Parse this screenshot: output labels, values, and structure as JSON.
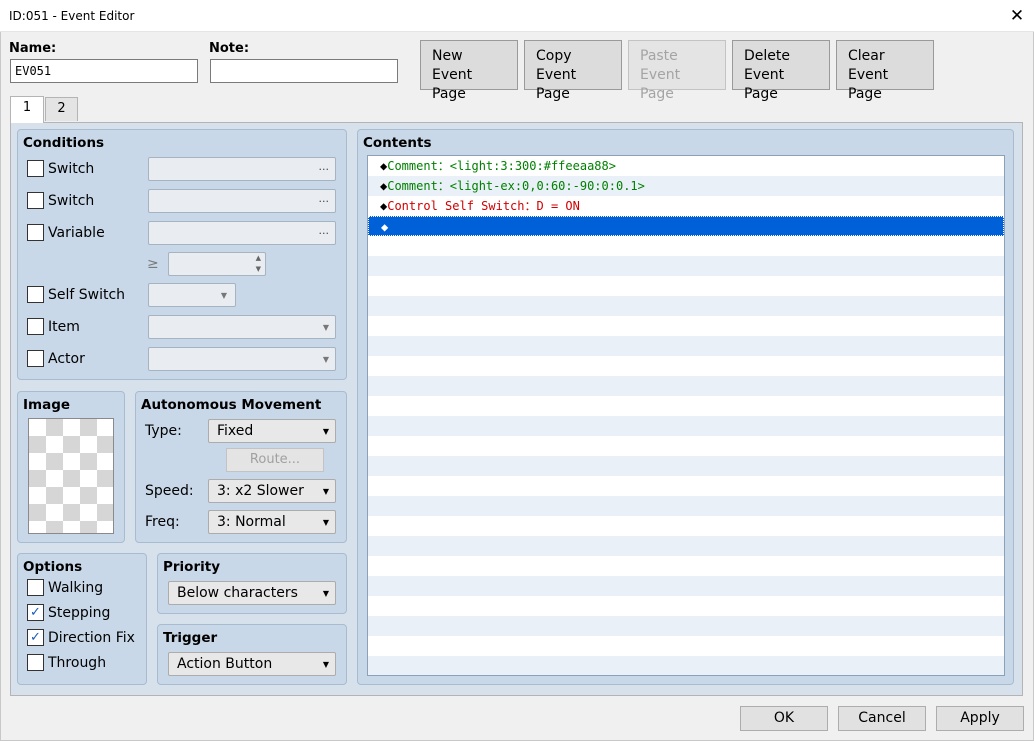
{
  "window": {
    "title": "ID:051 - Event Editor",
    "close_glyph": "✕"
  },
  "header": {
    "name_label": "Name:",
    "name_value": "EV051",
    "note_label": "Note:",
    "note_value": "",
    "buttons": {
      "new": [
        "New",
        "Event Page"
      ],
      "copy": [
        "Copy",
        "Event Page"
      ],
      "paste": [
        "Paste",
        "Event Page"
      ],
      "delete": [
        "Delete",
        "Event Page"
      ],
      "clear": [
        "Clear",
        "Event Page"
      ]
    }
  },
  "tabs": [
    "1",
    "2"
  ],
  "conditions": {
    "title": "Conditions",
    "switch1": "Switch",
    "switch2": "Switch",
    "variable": "Variable",
    "ellipsis": "...",
    "ge": "≥",
    "self_switch": "Self Switch",
    "item": "Item",
    "actor": "Actor"
  },
  "image": {
    "title": "Image"
  },
  "movement": {
    "title": "Autonomous Movement",
    "type_label": "Type:",
    "type_value": "Fixed",
    "route_label": "Route...",
    "speed_label": "Speed:",
    "speed_value": "3: x2 Slower",
    "freq_label": "Freq:",
    "freq_value": "3: Normal"
  },
  "options": {
    "title": "Options",
    "walking": "Walking",
    "stepping": "Stepping",
    "direction_fix": "Direction Fix",
    "through": "Through",
    "walking_checked": false,
    "stepping_checked": true,
    "direction_fix_checked": true,
    "through_checked": false
  },
  "priority": {
    "title": "Priority",
    "value": "Below characters"
  },
  "trigger": {
    "title": "Trigger",
    "value": "Action Button"
  },
  "contents": {
    "title": "Contents",
    "rows": [
      {
        "marker": "◆",
        "text": "Comment：<light:3:300:#ffeeaa88>",
        "color": "#008000"
      },
      {
        "marker": "◆",
        "text": "Comment：<light-ex:0,0:60:-90:0:0.1>",
        "color": "#008000"
      },
      {
        "marker": "◆",
        "text": "Control Self Switch：D = ON",
        "color": "#d00000"
      },
      {
        "marker": "◆",
        "text": "",
        "color": "#ffffff"
      }
    ],
    "selected_index": 3,
    "selection_color": "#0060d7"
  },
  "footer": {
    "ok": "OK",
    "cancel": "Cancel",
    "apply": "Apply"
  }
}
